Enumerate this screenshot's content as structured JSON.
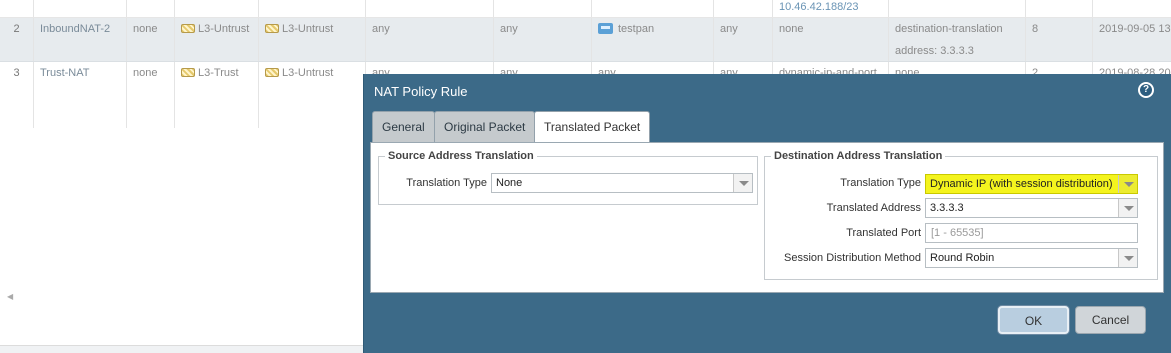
{
  "table": {
    "top_row": {
      "translated_dst": "10.46.42.188/23"
    },
    "rows": [
      {
        "num": "2",
        "name": "InboundNAT-2",
        "tags": "none",
        "source_zone": "L3-Untrust",
        "destination_zone": "L3-Untrust",
        "source_address": "any",
        "destination_address": "any",
        "service": "testpan",
        "dest_interface": "any",
        "translated_source": "none",
        "translated_destination": "destination-translation",
        "translated_destination_addr": "address: 3.3.3.3",
        "hit_count": "8",
        "modified": "2019-09-05 13"
      },
      {
        "num": "3",
        "name": "Trust-NAT",
        "tags": "none",
        "source_zone": "L3-Trust",
        "destination_zone": "L3-Untrust",
        "source_address": "any",
        "destination_address": "any",
        "service": "any",
        "dest_interface": "any",
        "translated_source": "dynamic-ip-and-port",
        "translated_destination": "none",
        "hit_count": "2",
        "modified": "2019-08-28 20"
      }
    ]
  },
  "dialog": {
    "title": "NAT Policy Rule",
    "help_icon": "?",
    "tabs": [
      {
        "label": "General"
      },
      {
        "label": "Original Packet"
      },
      {
        "label": "Translated Packet",
        "active": true
      }
    ],
    "source_translation": {
      "legend": "Source Address Translation",
      "translation_type_label": "Translation Type",
      "translation_type_value": "None"
    },
    "destination_translation": {
      "legend": "Destination Address Translation",
      "translation_type_label": "Translation Type",
      "translation_type_value": "Dynamic IP (with session distribution)",
      "translated_address_label": "Translated Address",
      "translated_address_value": "3.3.3.3",
      "translated_port_label": "Translated Port",
      "translated_port_placeholder": "[1 - 65535]",
      "session_distribution_label": "Session Distribution Method",
      "session_distribution_value": "Round Robin"
    },
    "buttons": {
      "ok": "OK",
      "cancel": "Cancel"
    },
    "colors": {
      "header_bg": "#3c6a88",
      "highlight": "#f4f41e"
    }
  }
}
